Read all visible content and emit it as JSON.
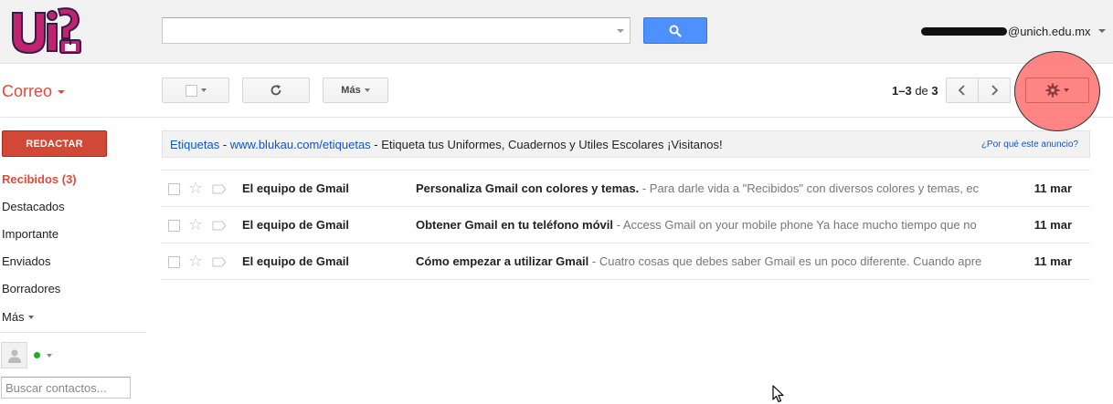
{
  "header": {
    "logo_alt": "UNICH",
    "search": {
      "value": "",
      "placeholder": ""
    },
    "account": {
      "email_suffix": "@unich.edu.mx"
    }
  },
  "toolbar": {
    "app_name": "Correo",
    "more_label": "Más",
    "pager": {
      "range": "1–3",
      "of_label": "de",
      "total": "3"
    }
  },
  "sidebar": {
    "compose_label": "REDACTAR",
    "items": [
      {
        "label": "Recibidos (3)",
        "active": true
      },
      {
        "label": "Destacados"
      },
      {
        "label": "Importante"
      },
      {
        "label": "Enviados"
      },
      {
        "label": "Borradores"
      }
    ],
    "more_label": "Más",
    "contacts_placeholder": "Buscar contactos..."
  },
  "ad": {
    "label1": "Etiquetas",
    "sep1": " - ",
    "url": "www.blukau.com/etiquetas",
    "sep2": " - ",
    "text": "Etiqueta tus Uniformes, Cuadernos y Utiles Escolares ¡Visitanos!",
    "why": "¿Por qué este anuncio?"
  },
  "mails": [
    {
      "sender": "El equipo de Gmail",
      "subject": "Personaliza Gmail con colores y temas.",
      "snippet": " - Para darle vida a \"Recibidos\" con diversos colores y temas, ec",
      "date": "11 mar"
    },
    {
      "sender": "El equipo de Gmail",
      "subject": "Obtener Gmail en tu teléfono móvil",
      "snippet": " - Access Gmail on your mobile phone Ya hace mucho tiempo que no",
      "date": "11 mar"
    },
    {
      "sender": "El equipo de Gmail",
      "subject": "Cómo empezar a utilizar Gmail",
      "snippet": " - Cuatro cosas que debes saber Gmail es un poco diferente. Cuando apre",
      "date": "11 mar"
    }
  ],
  "colors": {
    "accent_red": "#dd4b39",
    "compose_red": "#d14836",
    "search_blue": "#4d90fe",
    "link_blue": "#1155cc",
    "highlight": "#ff6e6e"
  }
}
